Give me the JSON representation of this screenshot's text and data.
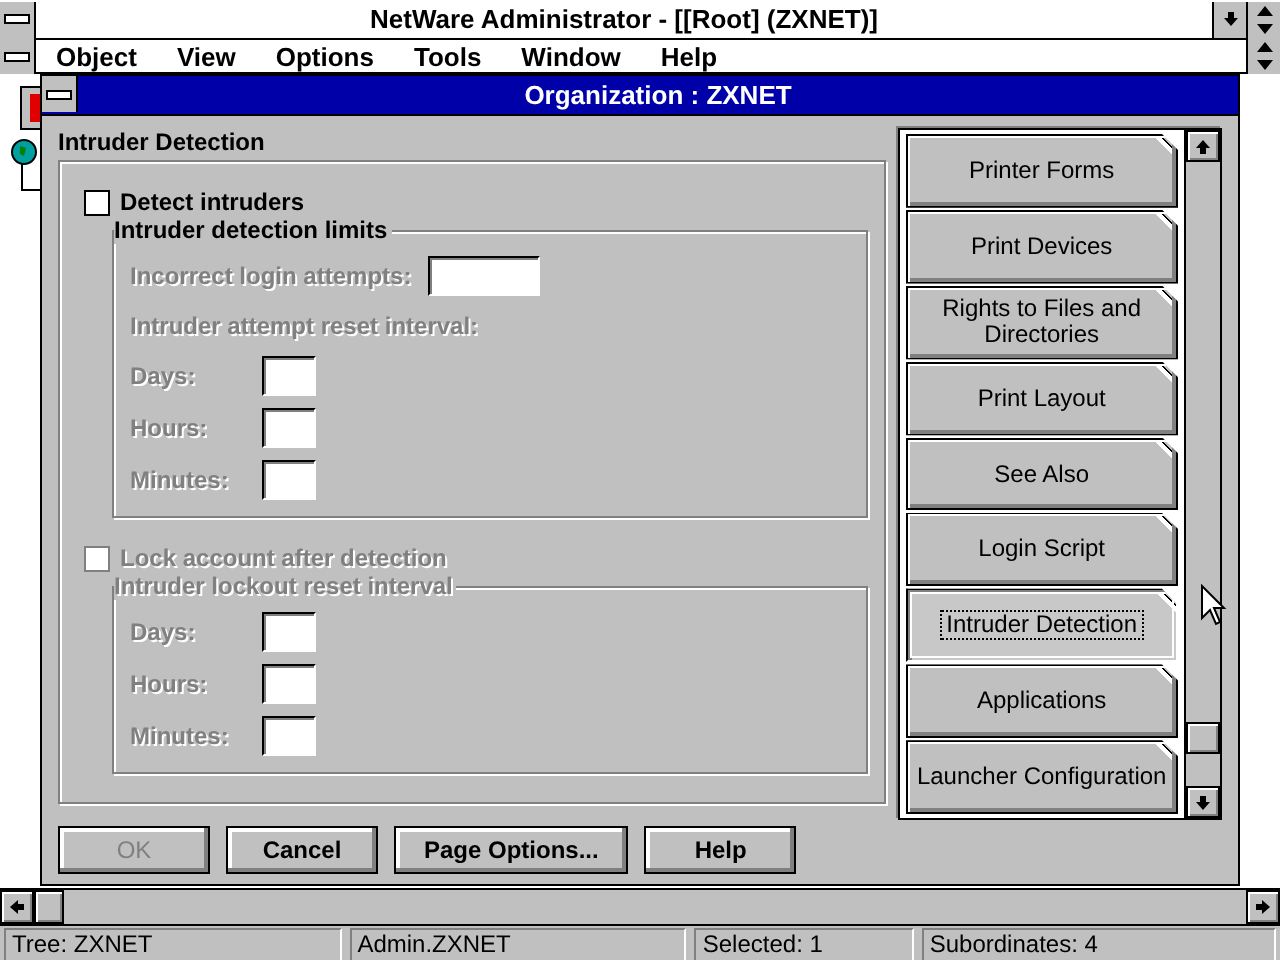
{
  "app_window": {
    "title": "NetWare Administrator - [[Root] (ZXNET)]"
  },
  "menu": [
    {
      "label": "Object"
    },
    {
      "label": "View"
    },
    {
      "label": "Options"
    },
    {
      "label": "Tools"
    },
    {
      "label": "Window"
    },
    {
      "label": "Help"
    }
  ],
  "dialog": {
    "title": "Organization : ZXNET",
    "page_title": "Intruder Detection",
    "detect": {
      "label": "Detect intruders",
      "checked": false,
      "disabled": false
    },
    "limits_group": {
      "title": "Intruder detection limits",
      "disabled": false,
      "rows": [
        {
          "kind": "wide_field",
          "label": "Incorrect login attempts:",
          "disabled": true
        },
        {
          "kind": "caption",
          "label": "Intruder attempt reset interval:",
          "disabled": true
        },
        {
          "kind": "field",
          "label": "Days:",
          "disabled": true
        },
        {
          "kind": "field",
          "label": "Hours:",
          "disabled": true
        },
        {
          "kind": "field",
          "label": "Minutes:",
          "disabled": true
        }
      ]
    },
    "lock": {
      "label": "Lock account after detection",
      "checked": false,
      "disabled": true
    },
    "lockout_group": {
      "title": "Intruder lockout reset interval",
      "disabled": true,
      "rows": [
        {
          "kind": "field",
          "label": "Days:",
          "disabled": true
        },
        {
          "kind": "field",
          "label": "Hours:",
          "disabled": true
        },
        {
          "kind": "field",
          "label": "Minutes:",
          "disabled": true
        }
      ]
    },
    "buttons": [
      {
        "label": "OK",
        "disabled": true
      },
      {
        "label": "Cancel",
        "disabled": false
      },
      {
        "label": "Page Options...",
        "disabled": false
      },
      {
        "label": "Help",
        "disabled": false
      }
    ],
    "pages": [
      {
        "label": "Printer Forms",
        "selected": false
      },
      {
        "label": "Print Devices",
        "selected": false
      },
      {
        "label": "Rights to Files and Directories",
        "selected": false
      },
      {
        "label": "Print Layout",
        "selected": false
      },
      {
        "label": "See Also",
        "selected": false
      },
      {
        "label": "Login Script",
        "selected": false
      },
      {
        "label": "Intruder Detection",
        "selected": true
      },
      {
        "label": "Applications",
        "selected": false
      },
      {
        "label": "Launcher Configuration",
        "selected": false
      }
    ]
  },
  "status_bar": [
    {
      "text": "Tree: ZXNET"
    },
    {
      "text": "Admin.ZXNET"
    },
    {
      "text": "Selected: 1"
    },
    {
      "text": "Subordinates: 4"
    }
  ]
}
